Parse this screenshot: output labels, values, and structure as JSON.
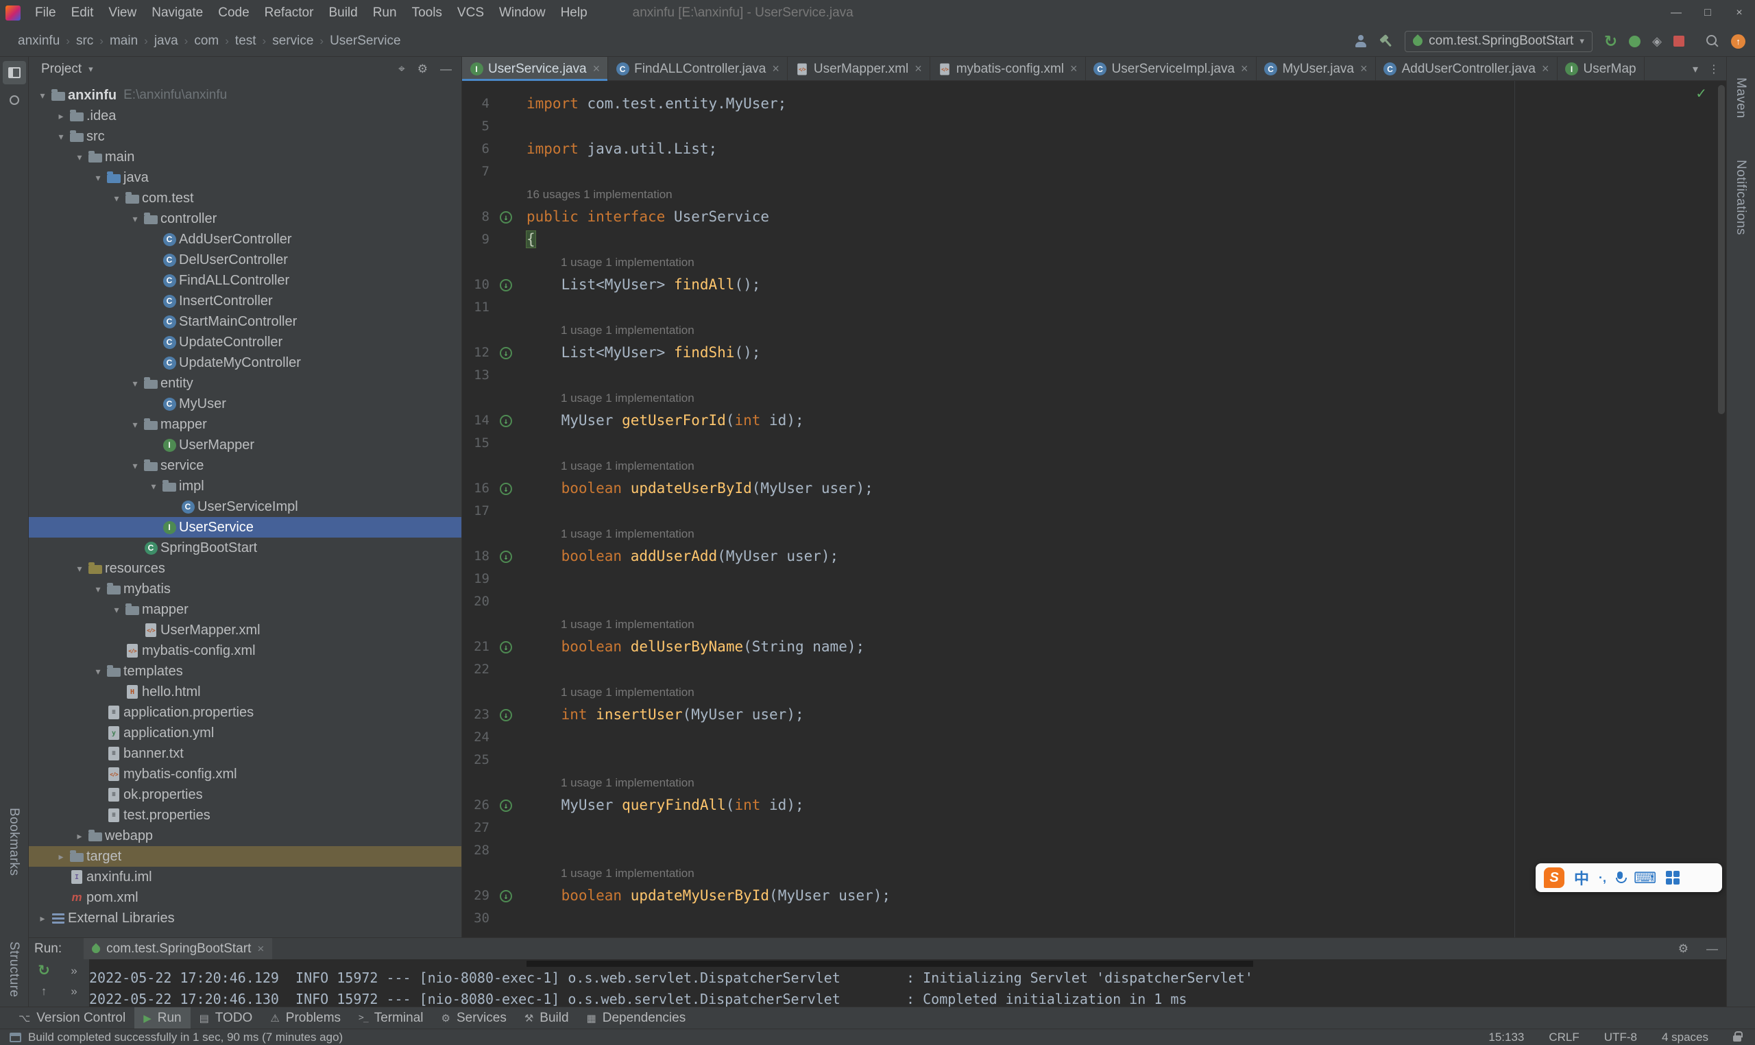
{
  "colors": {
    "editor_bg": "#2B2B2B",
    "panel_bg": "#3C3F41",
    "border": "#323232",
    "text": "#A9B7C6",
    "ui_text": "#BBBDBF",
    "keyword": "#CC7832",
    "method": "#FFC66D",
    "hint": "#787878",
    "line_number": "#606366",
    "selection": "#456198",
    "excluded_row": "#6B6040",
    "green": "#5B9E5B",
    "red": "#C75450",
    "tab_underline": "#4A88C7",
    "update_orange": "#E3863A",
    "brace_highlight_bg": "#3A5336"
  },
  "icon_glyphs": {
    "chevron-open": "▾",
    "chevron-closed": "▸",
    "caret-down": "▾",
    "close": "×",
    "more": "⋮",
    "settings-gear": "⚙",
    "locate": "⌖",
    "hide": "—",
    "window-minimize": "—",
    "window-maximize": "□",
    "window-close": "×",
    "rerun": "↻",
    "up-arrow": "↑",
    "double-chevron": "»",
    "check": "✓",
    "keyboard": "⌨",
    "crumb-sep": "›",
    "impl-arrow": "↓",
    "vcs": "⌥",
    "run": "▶",
    "todo": "▤",
    "problems": "⚠",
    "terminal": ">_",
    "services": "⚙",
    "build": "⚒",
    "dependencies": "▦",
    "coverage": "◈"
  },
  "titlebar": {
    "menus": [
      "File",
      "Edit",
      "View",
      "Navigate",
      "Code",
      "Refactor",
      "Build",
      "Run",
      "Tools",
      "VCS",
      "Window",
      "Help"
    ],
    "title": "anxinfu [E:\\anxinfu] - UserService.java"
  },
  "navbar": {
    "breadcrumbs": [
      "anxinfu",
      "src",
      "main",
      "java",
      "com",
      "test",
      "service",
      "UserService"
    ],
    "run_config": "com.test.SpringBootStart"
  },
  "stripes": {
    "left_bottom": [
      "Bookmarks",
      "Structure"
    ],
    "right": [
      "Maven",
      "Notifications"
    ]
  },
  "project_panel": {
    "title": "Project",
    "tree": [
      {
        "d": 0,
        "ch": "o",
        "ic": "folder",
        "t": "anxinfu",
        "sub": "E:\\anxinfu\\anxinfu",
        "bold": true
      },
      {
        "d": 1,
        "ch": "c",
        "ic": "folder",
        "t": ".idea"
      },
      {
        "d": 1,
        "ch": "o",
        "ic": "folder",
        "t": "src"
      },
      {
        "d": 2,
        "ch": "o",
        "ic": "folder",
        "t": "main"
      },
      {
        "d": 3,
        "ch": "o",
        "ic": "srcfolder",
        "t": "java"
      },
      {
        "d": 4,
        "ch": "o",
        "ic": "pkg",
        "t": "com.test"
      },
      {
        "d": 5,
        "ch": "o",
        "ic": "pkg",
        "t": "controller"
      },
      {
        "d": 6,
        "ic": "class",
        "t": "AddUserController"
      },
      {
        "d": 6,
        "ic": "class",
        "t": "DelUserController"
      },
      {
        "d": 6,
        "ic": "class",
        "t": "FindALLController"
      },
      {
        "d": 6,
        "ic": "class",
        "t": "InsertController"
      },
      {
        "d": 6,
        "ic": "class",
        "t": "StartMainController"
      },
      {
        "d": 6,
        "ic": "class",
        "t": "UpdateController"
      },
      {
        "d": 6,
        "ic": "class",
        "t": "UpdateMyController"
      },
      {
        "d": 5,
        "ch": "o",
        "ic": "pkg",
        "t": "entity"
      },
      {
        "d": 6,
        "ic": "class",
        "t": "MyUser"
      },
      {
        "d": 5,
        "ch": "o",
        "ic": "pkg",
        "t": "mapper"
      },
      {
        "d": 6,
        "ic": "interface",
        "t": "UserMapper"
      },
      {
        "d": 5,
        "ch": "o",
        "ic": "pkg",
        "t": "service"
      },
      {
        "d": 6,
        "ch": "o",
        "ic": "pkg",
        "t": "impl"
      },
      {
        "d": 7,
        "ic": "class",
        "t": "UserServiceImpl"
      },
      {
        "d": 6,
        "ic": "interface",
        "t": "UserService",
        "sel": true
      },
      {
        "d": 5,
        "ic": "boot",
        "t": "SpringBootStart"
      },
      {
        "d": 2,
        "ch": "o",
        "ic": "resfolder",
        "t": "resources"
      },
      {
        "d": 3,
        "ch": "o",
        "ic": "folder",
        "t": "mybatis"
      },
      {
        "d": 4,
        "ch": "o",
        "ic": "folder",
        "t": "mapper"
      },
      {
        "d": 5,
        "ic": "xml",
        "t": "UserMapper.xml"
      },
      {
        "d": 4,
        "ic": "xml",
        "t": "mybatis-config.xml"
      },
      {
        "d": 3,
        "ch": "o",
        "ic": "folder",
        "t": "templates"
      },
      {
        "d": 4,
        "ic": "html",
        "t": "hello.html"
      },
      {
        "d": 3,
        "ic": "prop",
        "t": "application.properties"
      },
      {
        "d": 3,
        "ic": "yml",
        "t": "application.yml"
      },
      {
        "d": 3,
        "ic": "txt",
        "t": "banner.txt"
      },
      {
        "d": 3,
        "ic": "xml",
        "t": "mybatis-config.xml"
      },
      {
        "d": 3,
        "ic": "prop",
        "t": "ok.properties"
      },
      {
        "d": 3,
        "ic": "prop",
        "t": "test.properties"
      },
      {
        "d": 2,
        "ch": "c",
        "ic": "folder",
        "t": "webapp"
      },
      {
        "d": 1,
        "ch": "c",
        "ic": "folder",
        "t": "target",
        "hl": true
      },
      {
        "d": 1,
        "ic": "iml",
        "t": "anxinfu.iml"
      },
      {
        "d": 1,
        "ic": "mvn",
        "t": "pom.xml"
      },
      {
        "d": 0,
        "ch": "c",
        "ic": "lib",
        "t": "External Libraries"
      }
    ]
  },
  "editor_tabs": [
    {
      "label": "UserService.java",
      "icon": "interface",
      "selected": true
    },
    {
      "label": "FindALLController.java",
      "icon": "class"
    },
    {
      "label": "UserMapper.xml",
      "icon": "xml"
    },
    {
      "label": "mybatis-config.xml",
      "icon": "xml"
    },
    {
      "label": "UserServiceImpl.java",
      "icon": "class"
    },
    {
      "label": "MyUser.java",
      "icon": "class"
    },
    {
      "label": "AddUserController.java",
      "icon": "class"
    },
    {
      "label": "UserMap",
      "icon": "interface",
      "truncated": true
    }
  ],
  "editor": {
    "lines": [
      {
        "n": "4",
        "s": [
          [
            "import ",
            "k"
          ],
          [
            "com.test.entity.MyUser;",
            "p"
          ]
        ]
      },
      {
        "n": "5",
        "s": []
      },
      {
        "n": "6",
        "s": [
          [
            "import ",
            "k"
          ],
          [
            "java.util.List;",
            "p"
          ]
        ]
      },
      {
        "n": "7",
        "s": []
      },
      {
        "h": "16 usages   1 implementation",
        "ind": 0
      },
      {
        "n": "8",
        "g": 1,
        "s": [
          [
            "public interface ",
            "k"
          ],
          [
            "UserService",
            "p"
          ]
        ]
      },
      {
        "n": "9",
        "s": [
          [
            "{",
            "b"
          ]
        ]
      },
      {
        "h": "1 usage   1 implementation",
        "ind": 1
      },
      {
        "n": "10",
        "g": 1,
        "s": [
          [
            "    List<MyUser> ",
            "p"
          ],
          [
            "findAll",
            "m"
          ],
          [
            "();",
            "p"
          ]
        ]
      },
      {
        "n": "11",
        "s": []
      },
      {
        "h": "1 usage   1 implementation",
        "ind": 1
      },
      {
        "n": "12",
        "g": 1,
        "s": [
          [
            "    List<MyUser> ",
            "p"
          ],
          [
            "findShi",
            "m"
          ],
          [
            "();",
            "p"
          ]
        ]
      },
      {
        "n": "13",
        "s": []
      },
      {
        "h": "1 usage   1 implementation",
        "ind": 1
      },
      {
        "n": "14",
        "g": 1,
        "s": [
          [
            "    MyUser ",
            "p"
          ],
          [
            "getUserForId",
            "m"
          ],
          [
            "(",
            "p"
          ],
          [
            "int",
            "k"
          ],
          [
            " id);",
            "p"
          ]
        ]
      },
      {
        "n": "15",
        "s": []
      },
      {
        "h": "1 usage   1 implementation",
        "ind": 1
      },
      {
        "n": "16",
        "g": 1,
        "s": [
          [
            "    ",
            "p"
          ],
          [
            "boolean",
            "k"
          ],
          [
            " ",
            "p"
          ],
          [
            "updateUserById",
            "m"
          ],
          [
            "(MyUser user);",
            "p"
          ]
        ]
      },
      {
        "n": "17",
        "s": []
      },
      {
        "h": "1 usage   1 implementation",
        "ind": 1
      },
      {
        "n": "18",
        "g": 1,
        "s": [
          [
            "    ",
            "p"
          ],
          [
            "boolean",
            "k"
          ],
          [
            " ",
            "p"
          ],
          [
            "addUserAdd",
            "m"
          ],
          [
            "(MyUser user);",
            "p"
          ]
        ]
      },
      {
        "n": "19",
        "s": []
      },
      {
        "n": "20",
        "s": []
      },
      {
        "h": "1 usage   1 implementation",
        "ind": 1
      },
      {
        "n": "21",
        "g": 1,
        "s": [
          [
            "    ",
            "p"
          ],
          [
            "boolean",
            "k"
          ],
          [
            " ",
            "p"
          ],
          [
            "delUserByName",
            "m"
          ],
          [
            "(String name);",
            "p"
          ]
        ]
      },
      {
        "n": "22",
        "s": []
      },
      {
        "h": "1 usage   1 implementation",
        "ind": 1
      },
      {
        "n": "23",
        "g": 1,
        "s": [
          [
            "    ",
            "p"
          ],
          [
            "int",
            "k"
          ],
          [
            " ",
            "p"
          ],
          [
            "insertUser",
            "m"
          ],
          [
            "(MyUser user);",
            "p"
          ]
        ]
      },
      {
        "n": "24",
        "s": []
      },
      {
        "n": "25",
        "s": []
      },
      {
        "h": "1 usage   1 implementation",
        "ind": 1
      },
      {
        "n": "26",
        "g": 1,
        "s": [
          [
            "    MyUser ",
            "p"
          ],
          [
            "queryFindAll",
            "m"
          ],
          [
            "(",
            "p"
          ],
          [
            "int",
            "k"
          ],
          [
            " id);",
            "p"
          ]
        ]
      },
      {
        "n": "27",
        "s": []
      },
      {
        "n": "28",
        "s": []
      },
      {
        "h": "1 usage   1 implementation",
        "ind": 1
      },
      {
        "n": "29",
        "g": 1,
        "s": [
          [
            "    ",
            "p"
          ],
          [
            "boolean",
            "k"
          ],
          [
            " ",
            "p"
          ],
          [
            "updateMyUserById",
            "m"
          ],
          [
            "(MyUser user);",
            "p"
          ]
        ]
      },
      {
        "n": "30",
        "s": []
      }
    ]
  },
  "run_panel": {
    "label": "Run:",
    "tab": "com.test.SpringBootStart",
    "console": [
      "2022-05-22 17:20:46.129  INFO 15972 --- [nio-8080-exec-1] o.s.web.servlet.DispatcherServlet        : Initializing Servlet 'dispatcherServlet'",
      "2022-05-22 17:20:46.130  INFO 15972 --- [nio-8080-exec-1] o.s.web.servlet.DispatcherServlet        : Completed initialization in 1 ms"
    ]
  },
  "tool_buttons": [
    {
      "label": "Version Control",
      "icon": "vcs"
    },
    {
      "label": "Run",
      "icon": "run",
      "active": true
    },
    {
      "label": "TODO",
      "icon": "todo"
    },
    {
      "label": "Problems",
      "icon": "problems"
    },
    {
      "label": "Terminal",
      "icon": "terminal"
    },
    {
      "label": "Services",
      "icon": "services"
    },
    {
      "label": "Build",
      "icon": "build"
    },
    {
      "label": "Dependencies",
      "icon": "dependencies"
    }
  ],
  "statusbar": {
    "message": "Build completed successfully in 1 sec, 90 ms (7 minutes ago)",
    "items": [
      "15:133",
      "CRLF",
      "UTF-8",
      "4 spaces"
    ]
  },
  "ime": {
    "logo": "S",
    "lang": "中",
    "punct": "·,"
  }
}
